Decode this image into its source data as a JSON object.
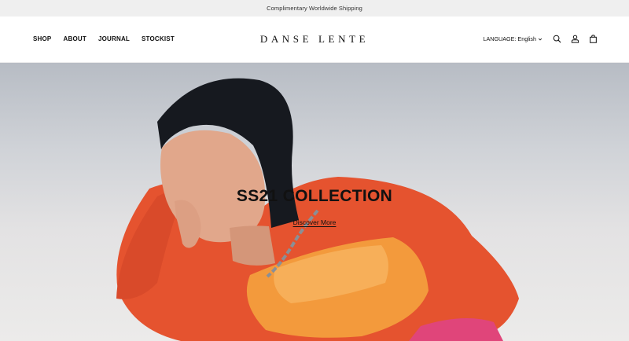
{
  "announcement": {
    "text": "Complimentary Worldwide Shipping"
  },
  "header": {
    "nav": [
      {
        "label": "SHOP"
      },
      {
        "label": "ABOUT"
      },
      {
        "label": "JOURNAL"
      },
      {
        "label": "STOCKIST"
      }
    ],
    "logo": "DANSE LENTE",
    "language_label": "LANGUAGE: English",
    "icons": [
      "search-icon",
      "account-icon",
      "bag-icon"
    ]
  },
  "hero": {
    "title": "SS21 COLLECTION",
    "link": "Discover More"
  },
  "colors": {
    "topbar": "#efefef",
    "header_bg": "#ffffff",
    "text": "#111111",
    "sweater": "#e5532f",
    "bag": "#f39a3c"
  }
}
